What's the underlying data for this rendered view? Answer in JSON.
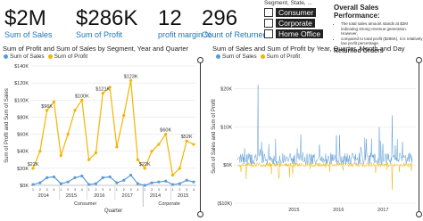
{
  "kpis": [
    {
      "value": "$2M",
      "label": "Sum of Sales"
    },
    {
      "value": "$286K",
      "label": "Sum of Profit"
    },
    {
      "value": "12",
      "label": "profit margin %"
    },
    {
      "value": "296",
      "label": "Count of Returned"
    }
  ],
  "slicer": {
    "header": "Segment, State, ...",
    "items": [
      "Consumer",
      "Corporate",
      "Home Office"
    ]
  },
  "summary": {
    "title": "Overall Sales Performance:",
    "bullets": [
      "The total sales amount stands at $2M indicating strong revenue generation. However,",
      "compared to total profit ($286K), it is relatively low profit percentage."
    ],
    "cut_heading": "Returned Orders"
  },
  "colors": {
    "sales": "#f5b400",
    "profit": "#5b9bd5",
    "accent": "#1f77b4"
  },
  "chart_data": [
    {
      "type": "line",
      "title": "Sum of Profit and Sum of Sales by Segment, Year and Quarter",
      "xlabel": "Quarter",
      "ylabel": "Sum of Profit and Sum of Sales",
      "yticks": [
        "$0K",
        "$20K",
        "$40K",
        "$60K",
        "$80K",
        "$100K",
        "$120K",
        "$140K"
      ],
      "ylim": [
        0,
        140
      ],
      "years": [
        "2014",
        "2015",
        "2016",
        "2017",
        "2014",
        "2015"
      ],
      "segments": [
        "Consumer",
        "Corporate"
      ],
      "series": [
        {
          "name": "Sum of Sales",
          "values": [
            20,
            40,
            88,
            98,
            35,
            60,
            88,
            100,
            30,
            38,
            108,
            115,
            45,
            82,
            123,
            30,
            20,
            40,
            48,
            60,
            12,
            20,
            52,
            48
          ]
        },
        {
          "name": "Sum of Profit",
          "values": [
            1,
            3,
            9,
            10,
            2,
            4,
            9,
            11,
            1,
            2,
            9,
            10,
            3,
            6,
            12,
            2,
            0,
            3,
            4,
            5,
            1,
            2,
            6,
            4
          ]
        }
      ],
      "data_labels": [
        "$22K",
        "$96K",
        "$100K",
        "$121K",
        "$123K",
        "$22K",
        "$52K",
        "$60K",
        "$9K",
        "$6K",
        "$4K",
        "$11K",
        "$15K"
      ]
    },
    {
      "type": "line",
      "title": "Sum of Sales and Sum of Profit by Year, Quarter, Month and Day",
      "xlabel": "",
      "ylabel": "Sum of Sales and Sum of Profit",
      "yticks": [
        "($10K)",
        "$0K",
        "$10K",
        "$20K"
      ],
      "ylim": [
        -10,
        25
      ],
      "xticks": [
        "2015",
        "2016",
        "2017"
      ],
      "series": [
        {
          "name": "Sum of Sales"
        },
        {
          "name": "Sum of Profit"
        }
      ]
    }
  ]
}
